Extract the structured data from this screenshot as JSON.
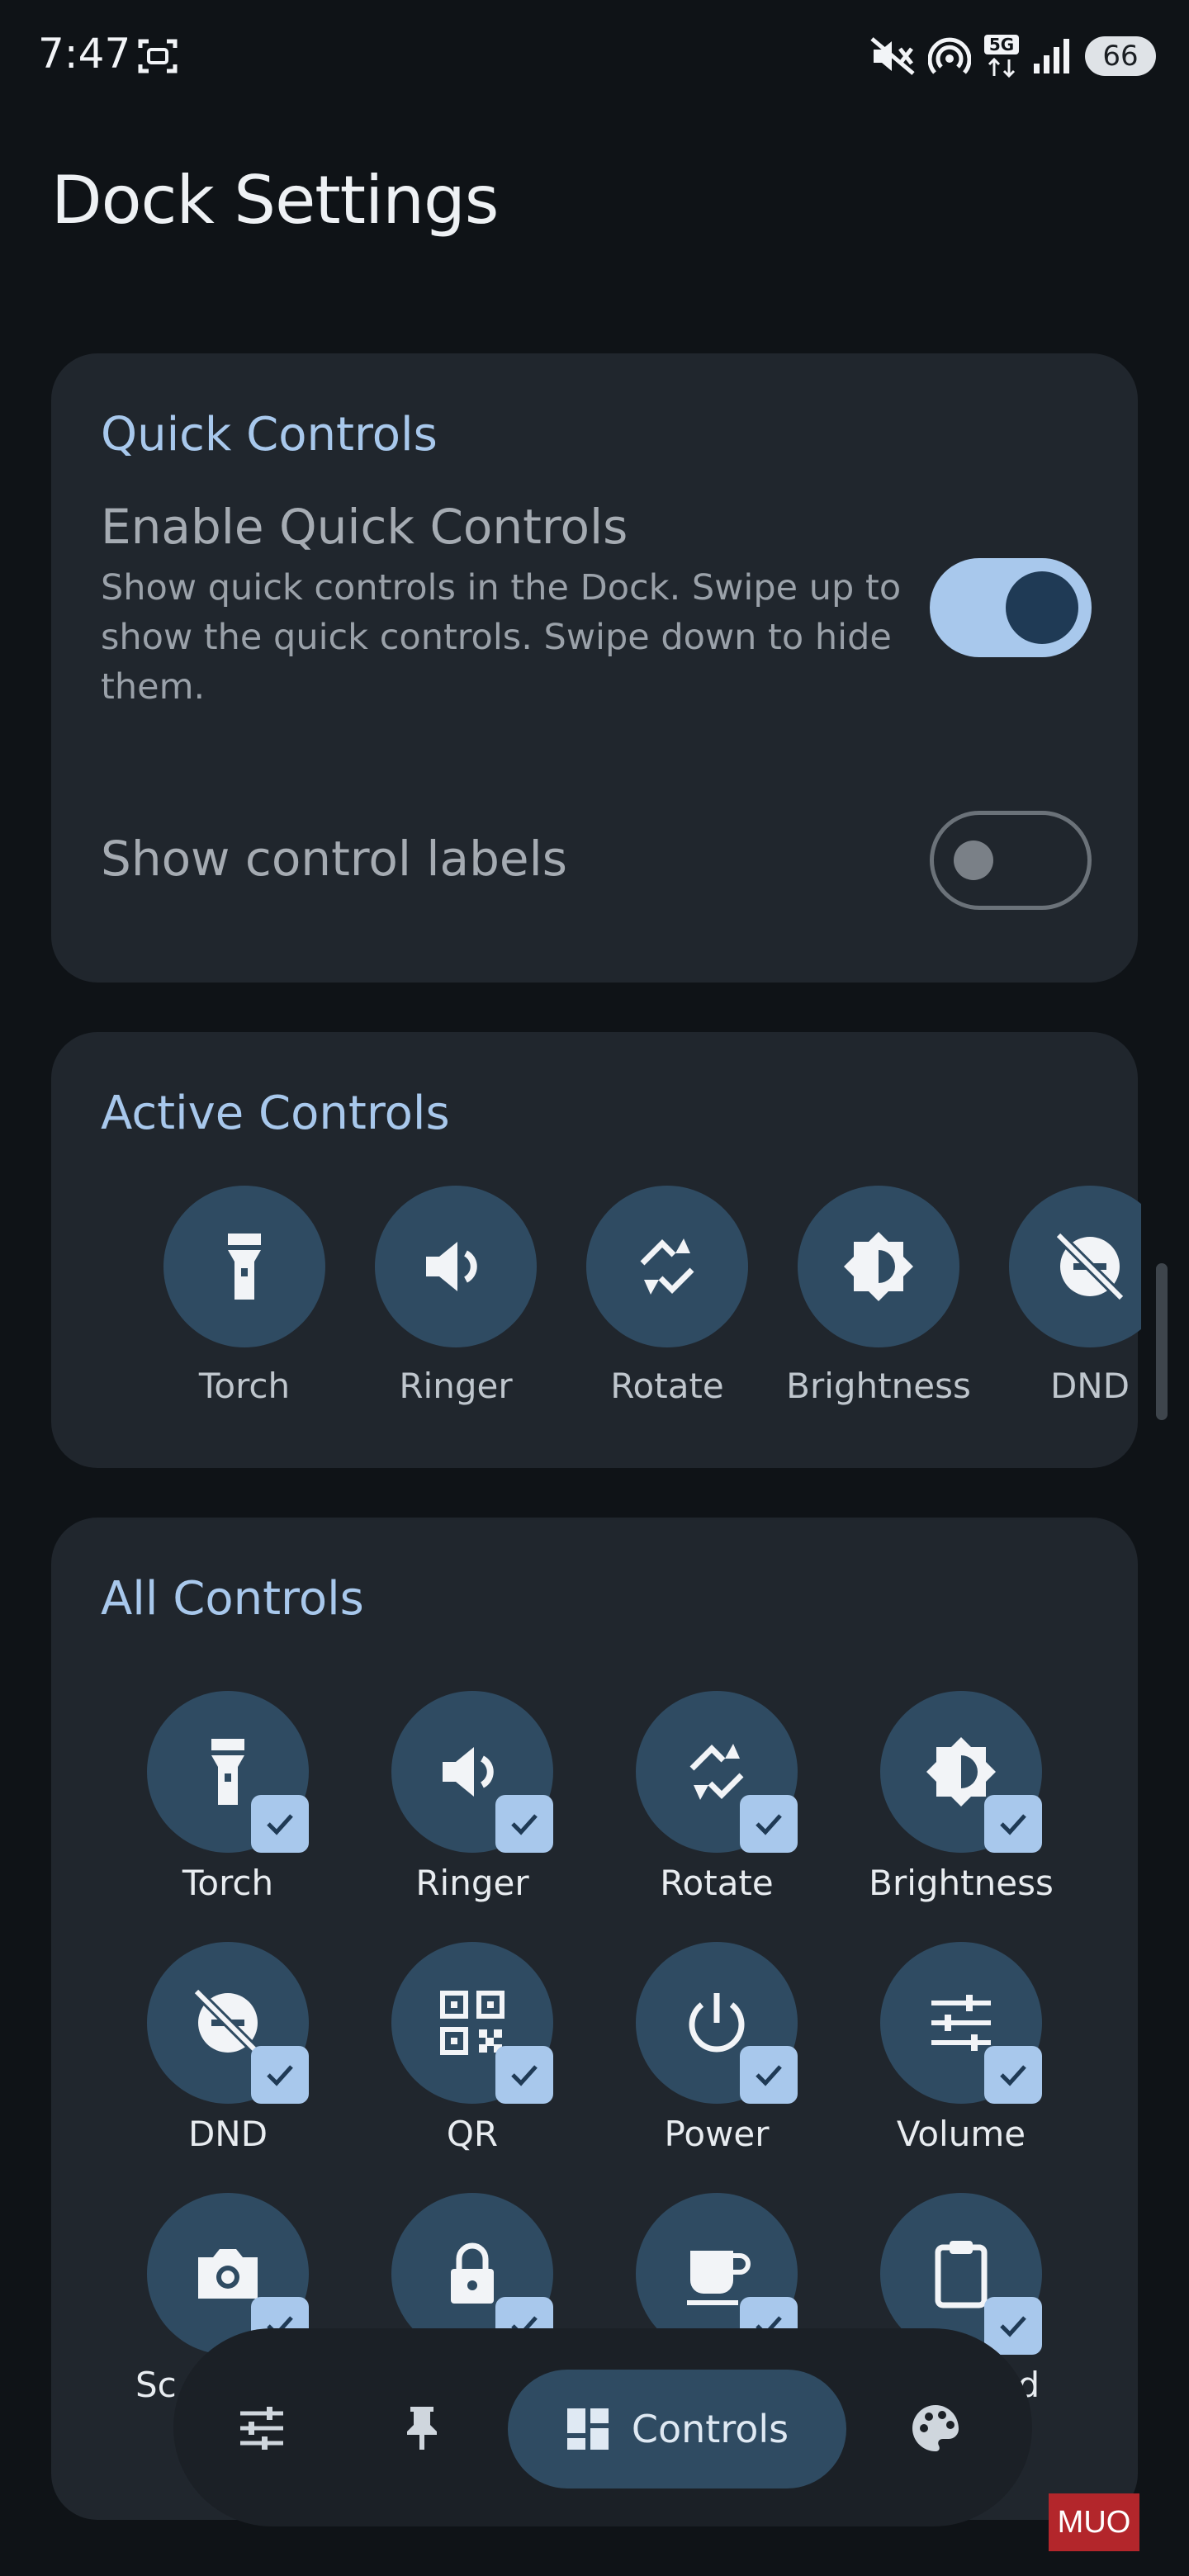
{
  "status_bar": {
    "time": "7:47",
    "icons": [
      "screenshot-icon",
      "mute-icon",
      "hotspot-icon",
      "5g-icon",
      "signal-icon"
    ],
    "battery": "66"
  },
  "page": {
    "title": "Dock Settings"
  },
  "quick_controls": {
    "heading": "Quick Controls",
    "enable": {
      "title": "Enable Quick Controls",
      "description": "Show quick controls in the Dock. Swipe up to show the quick controls. Swipe down to hide them.",
      "enabled": true
    },
    "labels": {
      "title": "Show control labels",
      "enabled": false
    }
  },
  "active_controls": {
    "heading": "Active Controls",
    "items": [
      {
        "label": "Torch",
        "icon": "torch-icon"
      },
      {
        "label": "Ringer",
        "icon": "ringer-icon"
      },
      {
        "label": "Rotate",
        "icon": "rotate-icon"
      },
      {
        "label": "Brightness",
        "icon": "brightness-icon"
      },
      {
        "label": "DND",
        "icon": "dnd-icon"
      }
    ]
  },
  "all_controls": {
    "heading": "All Controls",
    "items": [
      {
        "label": "Torch",
        "icon": "torch-icon",
        "checked": true
      },
      {
        "label": "Ringer",
        "icon": "ringer-icon",
        "checked": true
      },
      {
        "label": "Rotate",
        "icon": "rotate-icon",
        "checked": true
      },
      {
        "label": "Brightness",
        "icon": "brightness-icon",
        "checked": true
      },
      {
        "label": "DND",
        "icon": "dnd-icon",
        "checked": true
      },
      {
        "label": "QR",
        "icon": "qr-icon",
        "checked": true
      },
      {
        "label": "Power",
        "icon": "power-icon",
        "checked": true
      },
      {
        "label": "Volume",
        "icon": "volume-sliders-icon",
        "checked": true
      },
      {
        "label": "Sc",
        "icon": "camera-icon",
        "checked": true
      },
      {
        "label": "",
        "icon": "lock-icon",
        "checked": true
      },
      {
        "label": "",
        "icon": "coffee-icon",
        "checked": true
      },
      {
        "label": "rd",
        "icon": "clipboard-icon",
        "checked": true
      }
    ]
  },
  "bottom_nav": {
    "items": [
      {
        "icon": "tune-icon"
      },
      {
        "icon": "pin-icon"
      },
      {
        "icon": "controls-grid-icon",
        "label": "Controls",
        "active": true
      },
      {
        "icon": "palette-icon"
      }
    ]
  },
  "watermark": "MUO",
  "colors": {
    "accent": "#a8c8ec",
    "card": "#20262d",
    "control_circle": "#2f4b62",
    "background": "#0f1317"
  }
}
